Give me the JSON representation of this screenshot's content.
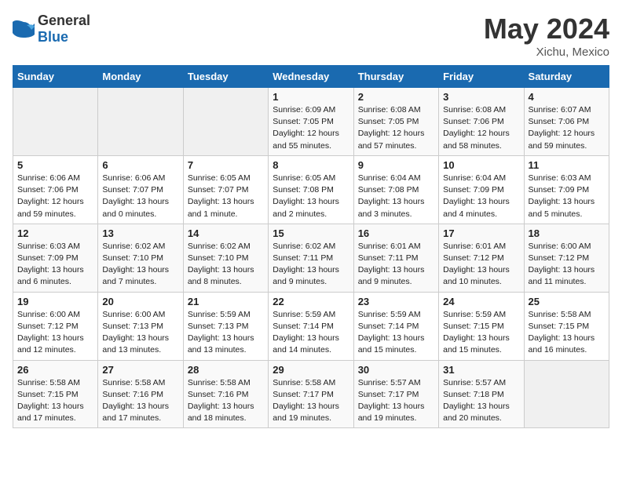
{
  "header": {
    "logo_general": "General",
    "logo_blue": "Blue",
    "title": "May 2024",
    "subtitle": "Xichu, Mexico"
  },
  "weekdays": [
    "Sunday",
    "Monday",
    "Tuesday",
    "Wednesday",
    "Thursday",
    "Friday",
    "Saturday"
  ],
  "weeks": [
    [
      {
        "day": "",
        "empty": true
      },
      {
        "day": "",
        "empty": true
      },
      {
        "day": "",
        "empty": true
      },
      {
        "day": "1",
        "sunrise": "6:09 AM",
        "sunset": "7:05 PM",
        "daylight": "12 hours and 55 minutes."
      },
      {
        "day": "2",
        "sunrise": "6:08 AM",
        "sunset": "7:05 PM",
        "daylight": "12 hours and 57 minutes."
      },
      {
        "day": "3",
        "sunrise": "6:08 AM",
        "sunset": "7:06 PM",
        "daylight": "12 hours and 58 minutes."
      },
      {
        "day": "4",
        "sunrise": "6:07 AM",
        "sunset": "7:06 PM",
        "daylight": "12 hours and 59 minutes."
      }
    ],
    [
      {
        "day": "5",
        "sunrise": "6:06 AM",
        "sunset": "7:06 PM",
        "daylight": "12 hours and 59 minutes."
      },
      {
        "day": "6",
        "sunrise": "6:06 AM",
        "sunset": "7:07 PM",
        "daylight": "13 hours and 0 minutes."
      },
      {
        "day": "7",
        "sunrise": "6:05 AM",
        "sunset": "7:07 PM",
        "daylight": "13 hours and 1 minute."
      },
      {
        "day": "8",
        "sunrise": "6:05 AM",
        "sunset": "7:08 PM",
        "daylight": "13 hours and 2 minutes."
      },
      {
        "day": "9",
        "sunrise": "6:04 AM",
        "sunset": "7:08 PM",
        "daylight": "13 hours and 3 minutes."
      },
      {
        "day": "10",
        "sunrise": "6:04 AM",
        "sunset": "7:09 PM",
        "daylight": "13 hours and 4 minutes."
      },
      {
        "day": "11",
        "sunrise": "6:03 AM",
        "sunset": "7:09 PM",
        "daylight": "13 hours and 5 minutes."
      }
    ],
    [
      {
        "day": "12",
        "sunrise": "6:03 AM",
        "sunset": "7:09 PM",
        "daylight": "13 hours and 6 minutes."
      },
      {
        "day": "13",
        "sunrise": "6:02 AM",
        "sunset": "7:10 PM",
        "daylight": "13 hours and 7 minutes."
      },
      {
        "day": "14",
        "sunrise": "6:02 AM",
        "sunset": "7:10 PM",
        "daylight": "13 hours and 8 minutes."
      },
      {
        "day": "15",
        "sunrise": "6:02 AM",
        "sunset": "7:11 PM",
        "daylight": "13 hours and 9 minutes."
      },
      {
        "day": "16",
        "sunrise": "6:01 AM",
        "sunset": "7:11 PM",
        "daylight": "13 hours and 9 minutes."
      },
      {
        "day": "17",
        "sunrise": "6:01 AM",
        "sunset": "7:12 PM",
        "daylight": "13 hours and 10 minutes."
      },
      {
        "day": "18",
        "sunrise": "6:00 AM",
        "sunset": "7:12 PM",
        "daylight": "13 hours and 11 minutes."
      }
    ],
    [
      {
        "day": "19",
        "sunrise": "6:00 AM",
        "sunset": "7:12 PM",
        "daylight": "13 hours and 12 minutes."
      },
      {
        "day": "20",
        "sunrise": "6:00 AM",
        "sunset": "7:13 PM",
        "daylight": "13 hours and 13 minutes."
      },
      {
        "day": "21",
        "sunrise": "5:59 AM",
        "sunset": "7:13 PM",
        "daylight": "13 hours and 13 minutes."
      },
      {
        "day": "22",
        "sunrise": "5:59 AM",
        "sunset": "7:14 PM",
        "daylight": "13 hours and 14 minutes."
      },
      {
        "day": "23",
        "sunrise": "5:59 AM",
        "sunset": "7:14 PM",
        "daylight": "13 hours and 15 minutes."
      },
      {
        "day": "24",
        "sunrise": "5:59 AM",
        "sunset": "7:15 PM",
        "daylight": "13 hours and 15 minutes."
      },
      {
        "day": "25",
        "sunrise": "5:58 AM",
        "sunset": "7:15 PM",
        "daylight": "13 hours and 16 minutes."
      }
    ],
    [
      {
        "day": "26",
        "sunrise": "5:58 AM",
        "sunset": "7:15 PM",
        "daylight": "13 hours and 17 minutes."
      },
      {
        "day": "27",
        "sunrise": "5:58 AM",
        "sunset": "7:16 PM",
        "daylight": "13 hours and 17 minutes."
      },
      {
        "day": "28",
        "sunrise": "5:58 AM",
        "sunset": "7:16 PM",
        "daylight": "13 hours and 18 minutes."
      },
      {
        "day": "29",
        "sunrise": "5:58 AM",
        "sunset": "7:17 PM",
        "daylight": "13 hours and 19 minutes."
      },
      {
        "day": "30",
        "sunrise": "5:57 AM",
        "sunset": "7:17 PM",
        "daylight": "13 hours and 19 minutes."
      },
      {
        "day": "31",
        "sunrise": "5:57 AM",
        "sunset": "7:18 PM",
        "daylight": "13 hours and 20 minutes."
      },
      {
        "day": "",
        "empty": true
      }
    ]
  ]
}
